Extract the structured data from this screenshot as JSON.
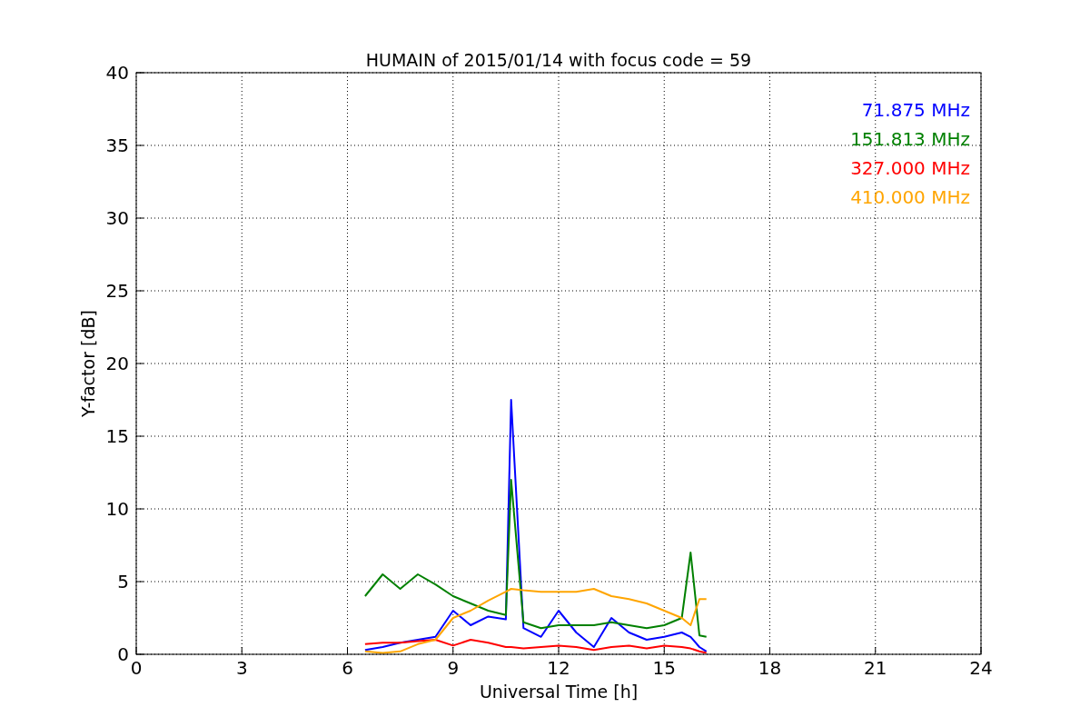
{
  "chart_data": {
    "type": "line",
    "title": "HUMAIN of 2015/01/14 with focus code = 59",
    "xlabel": "Universal Time [h]",
    "ylabel": "Y-factor [dB]",
    "x": [
      6.5,
      7,
      7.5,
      8,
      8.5,
      9,
      9.5,
      10,
      10.5,
      10.65,
      11,
      11.5,
      12,
      12.5,
      13,
      13.5,
      14,
      14.5,
      15,
      15.5,
      15.75,
      16,
      16.2
    ],
    "series": [
      {
        "name": "71.875 MHz",
        "color": "#0000ff",
        "values": [
          0.3,
          0.5,
          0.8,
          1.0,
          1.2,
          3.0,
          2.0,
          2.6,
          2.4,
          17.5,
          1.8,
          1.2,
          3.0,
          1.5,
          0.5,
          2.5,
          1.5,
          1.0,
          1.2,
          1.5,
          1.2,
          0.5,
          0.2
        ]
      },
      {
        "name": "151.813 MHz",
        "color": "#008000",
        "values": [
          4.0,
          5.5,
          4.5,
          5.5,
          4.8,
          4.0,
          3.5,
          3.0,
          2.7,
          12.0,
          2.2,
          1.8,
          2.0,
          2.0,
          2.0,
          2.2,
          2.0,
          1.8,
          2.0,
          2.5,
          7.0,
          1.3,
          1.2
        ]
      },
      {
        "name": "327.000 MHz",
        "color": "#ff0000",
        "values": [
          0.7,
          0.8,
          0.8,
          0.9,
          1.0,
          0.6,
          1.0,
          0.8,
          0.5,
          0.5,
          0.4,
          0.5,
          0.6,
          0.5,
          0.3,
          0.5,
          0.6,
          0.4,
          0.6,
          0.5,
          0.4,
          0.2,
          0.1
        ]
      },
      {
        "name": "410.000 MHz",
        "color": "#ffa500",
        "values": [
          0.2,
          0.1,
          0.2,
          0.7,
          1.0,
          2.5,
          3.0,
          3.7,
          4.3,
          4.5,
          4.4,
          4.3,
          4.3,
          4.3,
          4.5,
          4.0,
          3.8,
          3.5,
          3.0,
          2.5,
          2.0,
          3.8,
          3.8
        ]
      }
    ],
    "grid": true,
    "xlim": [
      0,
      24
    ],
    "ylim": [
      0,
      40
    ],
    "xticks": [
      0,
      3,
      6,
      9,
      12,
      15,
      18,
      21,
      24
    ],
    "yticks": [
      0,
      5,
      10,
      15,
      20,
      25,
      30,
      35,
      40
    ]
  }
}
